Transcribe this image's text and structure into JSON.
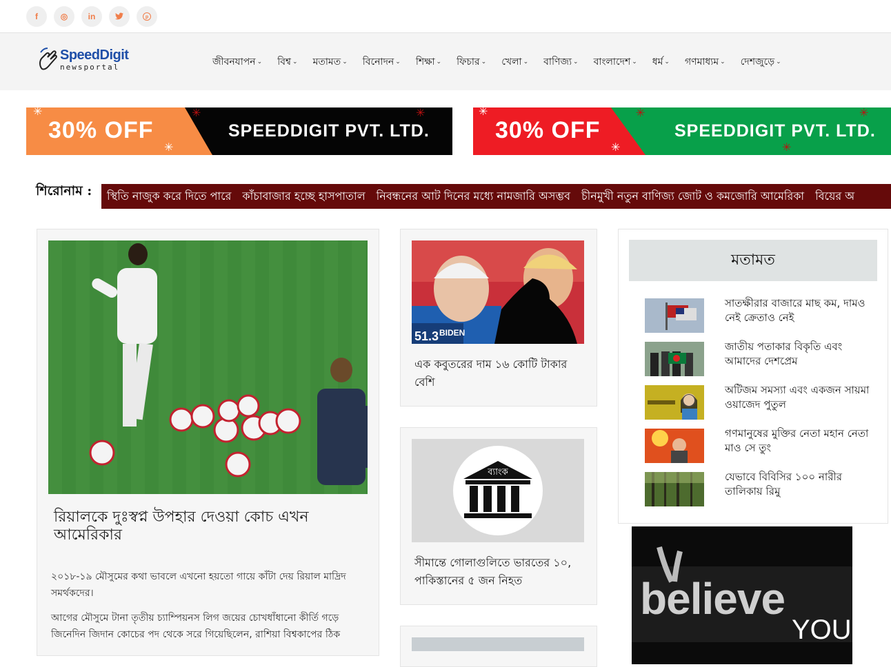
{
  "social": {
    "items": [
      {
        "icon": "facebook-icon",
        "glyph": "f"
      },
      {
        "icon": "instagram-icon",
        "glyph": "◎"
      },
      {
        "icon": "linkedin-icon",
        "glyph": "in"
      },
      {
        "icon": "twitter-icon",
        "glyph": "🐦"
      },
      {
        "icon": "pinterest-icon",
        "glyph": "℗"
      }
    ],
    "accent": "#f07e4a"
  },
  "logo": {
    "title": "SpeedDigit",
    "subtitle": "newsportal"
  },
  "nav": {
    "items": [
      "জীবনযাপন",
      "বিশ্ব",
      "মতামত",
      "বিনোদন",
      "শিক্ষা",
      "ফিচার",
      "খেলা",
      "বাণিজ্য",
      "বাংলাদেশ",
      "ধর্ম",
      "গণমাধ্যম",
      "দেশজুড়ে"
    ]
  },
  "ads": [
    {
      "discount": "30% OFF",
      "company": "SPEEDDIGIT PVT. LTD.",
      "left_color": "#f78c45",
      "right_color": "#050505"
    },
    {
      "discount": "30% OFF",
      "company": "SPEEDDIGIT PVT. LTD.",
      "left_color": "#ee1c24",
      "right_color": "#08a04a"
    }
  ],
  "ticker": {
    "label": "শিরোনাম :",
    "items": [
      "স্থিতি নাজুক করে দিতে পারে",
      "কাঁচাবাজার হচ্ছে হাসপাতাল",
      "নিবন্ধনের আট দিনের মধ্যে নামজারি অসম্ভব",
      "চীনমুখী নতুন বাণিজ্য জোট ও কমজোরি আমেরিকা",
      "বিয়ের অ"
    ],
    "bg": "#650a0a"
  },
  "lead": {
    "title": "রিয়ালকে দুঃস্বপ্ন উপহার দেওয়া কোচ এখন আমেরিকার",
    "p1": "২০১৮-১৯ মৌসুমের কথা ভাবলে এখনো হয়তো গায়ে কাঁটা দেয় রিয়াল মাদ্রিদ সমর্থকদের।",
    "p2": "আগের মৌসুমে টানা তৃতীয় চ্যাম্পিয়নস লিগ জয়ের চোখধাঁধানো কীর্তি গড়ে জিনেদিন জিদান কোচের পদ থেকে সরে গিয়েছিলেন, রাশিয়া বিশ্বকাপের ঠিক"
  },
  "middle": [
    {
      "title": "এক কবুতরের দাম ১৬ কোটি টাকার বেশি",
      "image_caption": "51.3 BIDEN"
    },
    {
      "title": "সীমান্তে গোলাগুলিতে ভারতের ১০, পাকিস্তানের ৫ জন নিহত",
      "image_caption": "ব্যাংক"
    }
  ],
  "opinion": {
    "heading": "মতামত",
    "items": [
      {
        "text": "সাতক্ষীরার বাজারে মাছ কম, দামও নেই ক্রেতাও নেই"
      },
      {
        "text": "জাতীয় পতাকার বিকৃতি এবং আমাদের দেশপ্রেম"
      },
      {
        "text": "অটিজম সমস্যা এবং একজন সায়মা ওয়াজেদ পুতুল"
      },
      {
        "text": "গণমানুষের মুক্তির নেতা মহান নেতা মাও সে তুং"
      },
      {
        "text": "যেভাবে বিবিসির ১০০ নারীর তালিকায় রিমু"
      }
    ]
  },
  "believe_ad": {
    "word": "believe",
    "sub": "YOU"
  }
}
